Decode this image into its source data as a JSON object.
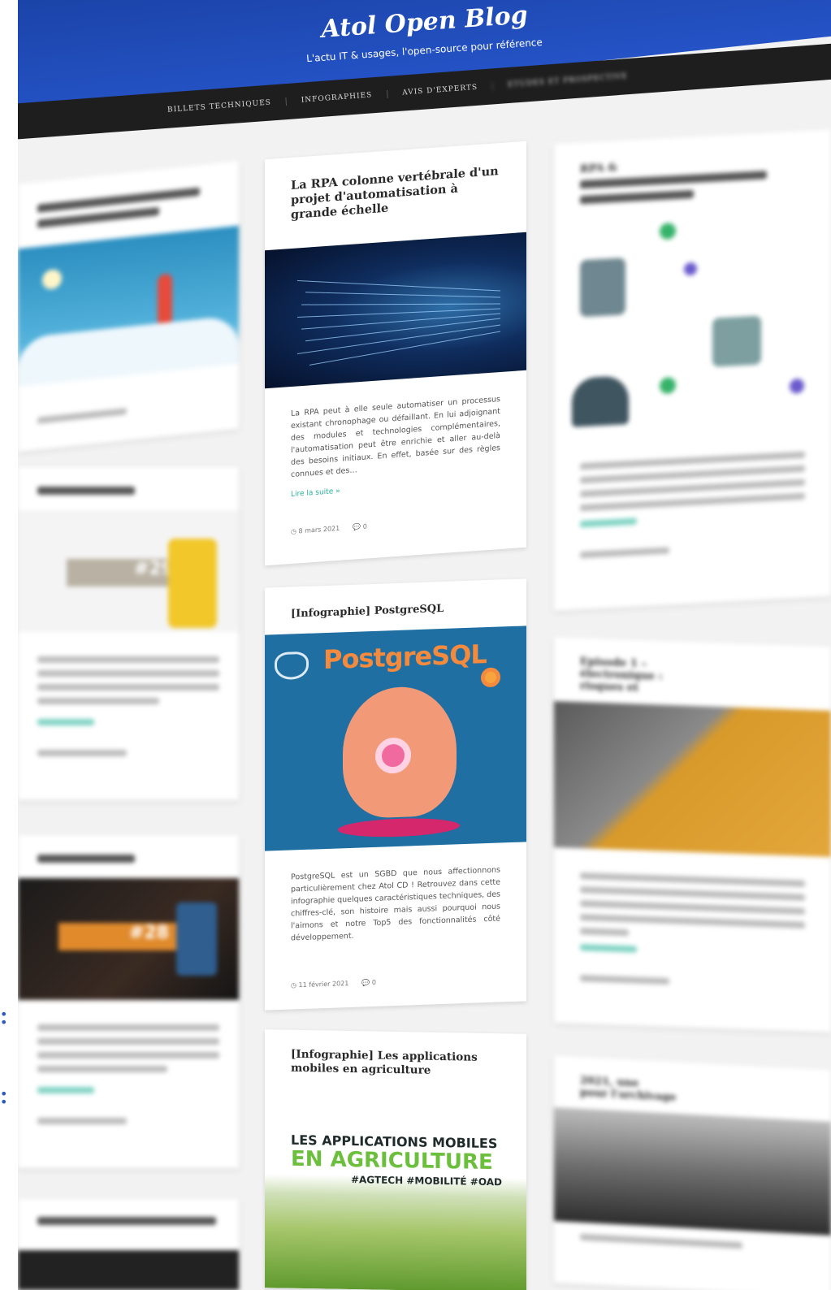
{
  "header": {
    "title": "Atol Open Blog",
    "tagline": "L'actu IT & usages, l'open-source pour référence",
    "nav": [
      "BILLETS TECHNIQUES",
      "INFOGRAPHIES",
      "AVIS D'EXPERTS",
      "ETUDES ET PROSPECTIVE"
    ]
  },
  "posts": [
    {
      "title": "La RPA colonne vertébrale d'un projet d'automatisation à grande échelle",
      "excerpt": "La RPA peut à elle seule automatiser un processus existant chronophage ou défaillant. En lui adjoignant des modules et technologies complémentaires, l'automatisation peut être enrichie et aller au-delà des besoins initiaux. En effet, basée sur des règles connues et des…",
      "more": "Lire la suite »",
      "date": "8 mars 2021",
      "comments": "0"
    },
    {
      "title": "[Infographie] PostgreSQL",
      "image_text": "PostgreSQL",
      "excerpt": "PostgreSQL est un SGBD que nous affectionnons particulièrement chez Atol CD ! Retrouvez dans cette infographie quelques caractéristiques techniques, des chiffres-clé, son histoire mais aussi pourquoi nous l'aimons et notre Top5 des fonctionnalités côté développement.",
      "date": "11 février 2021",
      "comments": "0"
    },
    {
      "title": "[Infographie] Les applications mobiles en agriculture",
      "image_line1": "LES APPLICATIONS MOBILES",
      "image_line2": "EN AGRICULTURE",
      "image_line3": "#AGTECH #MOBILITÉ #OAD"
    }
  ],
  "side_posts": {
    "r1_title": "RPA &",
    "r2_title": "Episode 1 –",
    "r2_title_2": "électronique :",
    "r2_title_3": "risques et",
    "r3_title": "2021, une",
    "r3_title_2": "pour l'archivage",
    "r2_badge": "#29",
    "l3_badge": "#28"
  },
  "colors": {
    "header_blue": "#2553c6",
    "nav_bg": "#1e1e1e",
    "accent_teal": "#2bb39b",
    "postgres_orange": "#f38a3d",
    "postgres_bg": "#1f6fa3"
  }
}
